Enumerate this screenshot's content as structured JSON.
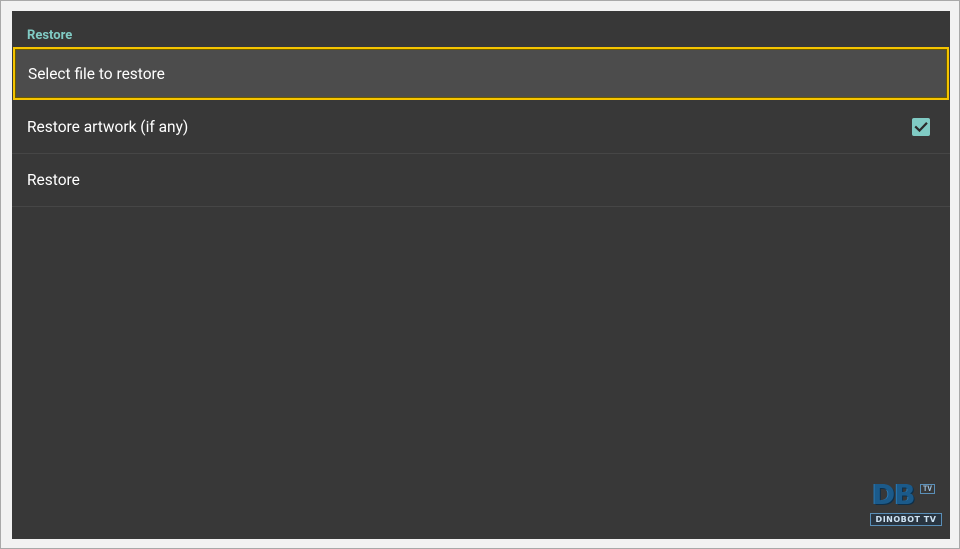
{
  "section": {
    "title": "Restore"
  },
  "items": [
    {
      "label": "Select file to restore",
      "focused": true
    },
    {
      "label": "Restore artwork (if any)",
      "checked": true
    },
    {
      "label": "Restore"
    }
  ],
  "watermark": {
    "logo_text": "DB",
    "badge": "TV",
    "name": "DINOBOT TV"
  },
  "colors": {
    "background": "#383838",
    "accent": "#80cbc4",
    "focus_border": "#f5c400",
    "text": "#ffffff"
  },
  "icons": {
    "checkbox": "checkbox-checked-icon"
  }
}
